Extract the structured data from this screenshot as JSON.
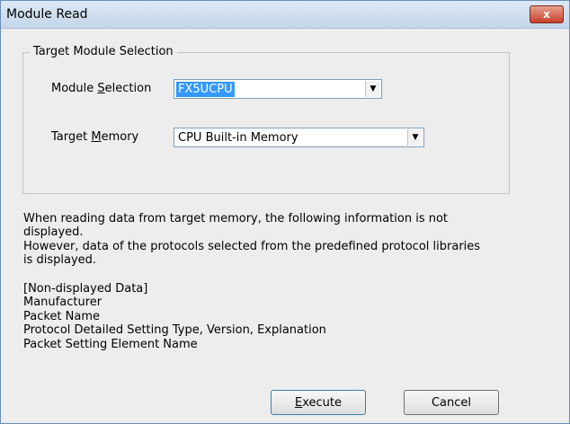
{
  "window": {
    "title": "Module Read",
    "close_label": "x"
  },
  "group": {
    "label": "Target Module Selection"
  },
  "module_selection": {
    "label_pre": "Module ",
    "label_accel": "S",
    "label_post": "election",
    "value": "FX5UCPU"
  },
  "target_memory": {
    "label_pre": "Target ",
    "label_accel": "M",
    "label_post": "emory",
    "value": "CPU Built-in Memory"
  },
  "info": {
    "line1": "When reading data from target memory, the following information is not",
    "line2": "displayed.",
    "line3": "However, data of the protocols selected from the predefined protocol libraries",
    "line4": "is displayed.",
    "line5": "[Non-displayed Data]",
    "line6": "Manufacturer",
    "line7": "Packet Name",
    "line8": "Protocol Detailed Setting Type, Version, Explanation",
    "line9": "Packet Setting Element Name"
  },
  "buttons": {
    "execute_accel": "E",
    "execute_rest": "xecute",
    "cancel": "Cancel"
  },
  "icons": {
    "dropdown": "chevron-down-icon",
    "close": "close-icon"
  }
}
